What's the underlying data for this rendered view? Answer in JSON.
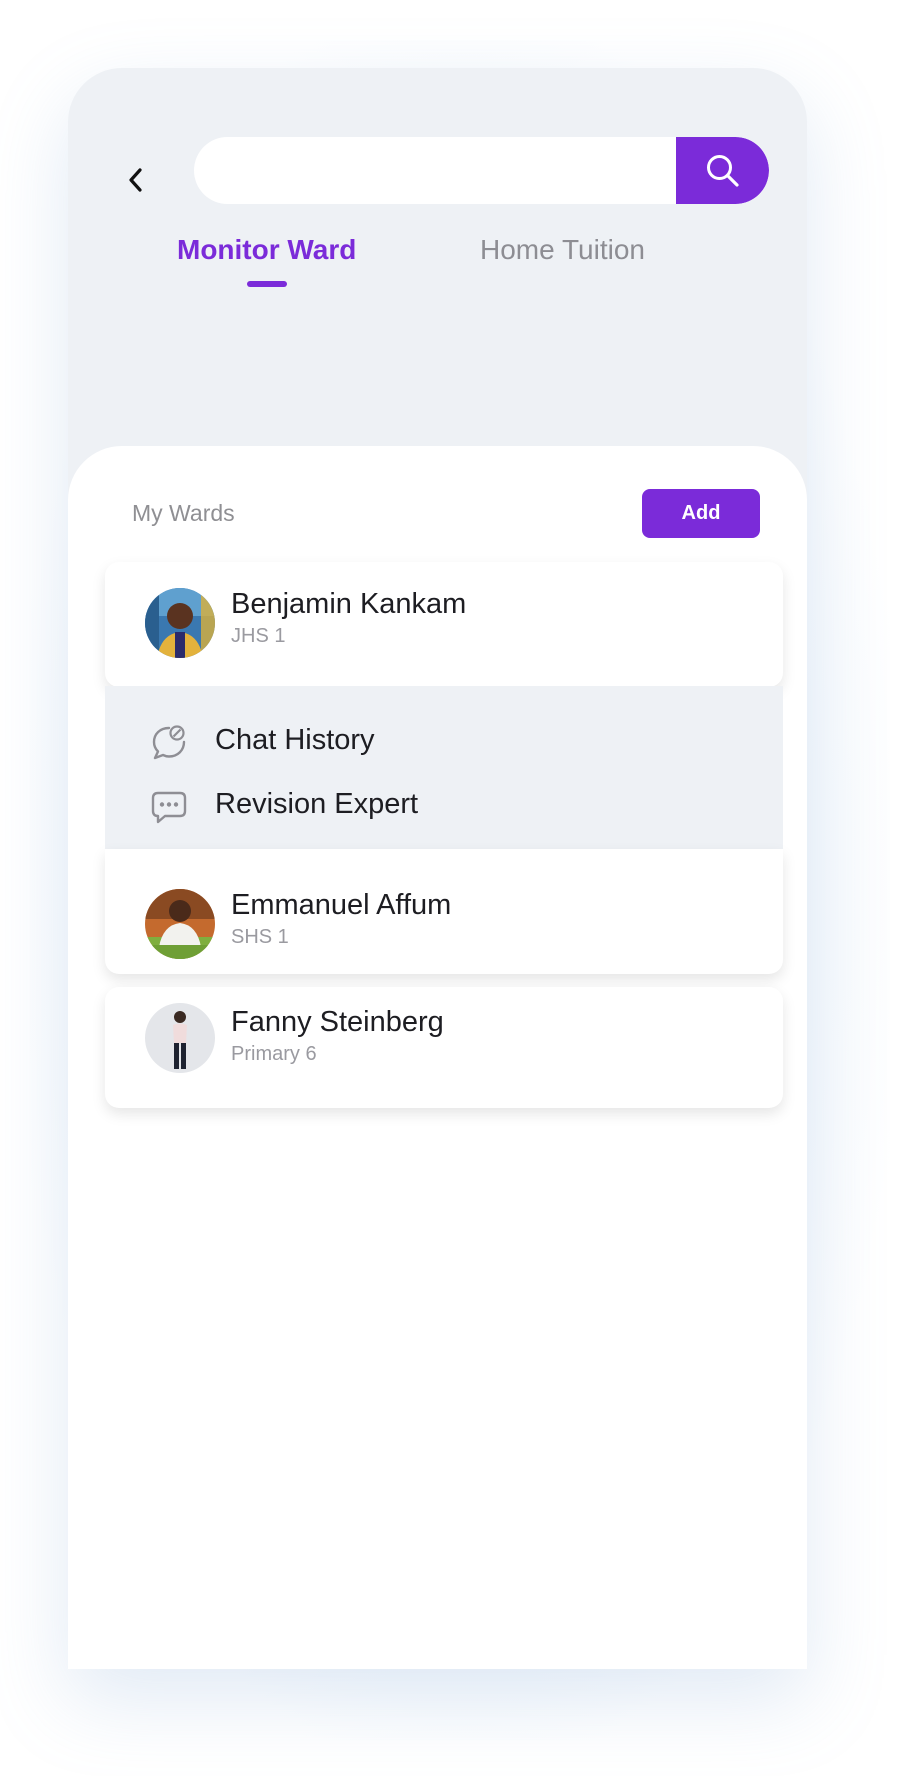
{
  "header": {
    "search": {
      "value": "",
      "placeholder": ""
    },
    "icons": {
      "back": "chevron-left-icon",
      "search": "search-icon"
    }
  },
  "tabs": [
    {
      "label": "Monitor Ward",
      "active": true
    },
    {
      "label": "Home Tuition",
      "active": false
    }
  ],
  "wards_section": {
    "title": "My Wards",
    "add_label": "Add"
  },
  "wards": [
    {
      "name": "Benjamin Kankam",
      "class": "JHS 1",
      "expanded": true
    },
    {
      "name": "Emmanuel Affum",
      "class": "SHS 1",
      "expanded": false
    },
    {
      "name": "Fanny Steinberg",
      "class": "Primary 6",
      "expanded": false
    }
  ],
  "ward_menu": [
    {
      "label": "Chat History",
      "icon": "chat-history-icon"
    },
    {
      "label": "Revision Expert",
      "icon": "chat-dots-icon"
    }
  ],
  "colors": {
    "accent": "#7b2bd9",
    "background": "#eef1f5",
    "inactive_text": "#8d8d93"
  }
}
